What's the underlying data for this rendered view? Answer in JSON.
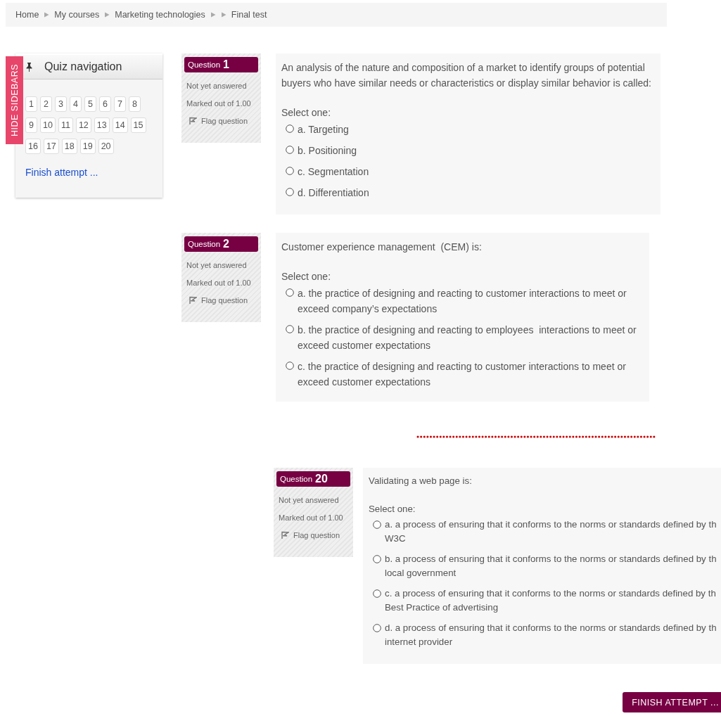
{
  "breadcrumb": [
    {
      "kind": "link",
      "label": "Home"
    },
    {
      "kind": "link",
      "label": "My courses"
    },
    {
      "kind": "link",
      "label": "Marketing technologies"
    },
    {
      "kind": "blank"
    },
    {
      "kind": "current",
      "label": "Final test"
    }
  ],
  "hide_sidebars": "HIDE SIDEBARS",
  "quiz_navigation": {
    "title": "Quiz navigation",
    "buttons": [
      "1",
      "2",
      "3",
      "4",
      "5",
      "6",
      "7",
      "8",
      "9",
      "10",
      "11",
      "12",
      "13",
      "14",
      "15",
      "16",
      "17",
      "18",
      "19",
      "20"
    ],
    "finish_link": "Finish attempt ..."
  },
  "questions": [
    {
      "label": "Question",
      "number": "1",
      "status": "Not yet answered",
      "mark": "Marked out of 1.00",
      "flag": "Flag question",
      "text": "An analysis of the nature and composition of a market to identify groups of potential buyers who have similar needs or characteristics or display similar behavior is called:",
      "prompt": "Select one:",
      "options": [
        {
          "lines": [
            "a. Targeting"
          ],
          "selected": false
        },
        {
          "lines": [
            "b. Positioning"
          ],
          "selected": false
        },
        {
          "lines": [
            "c. Segmentation"
          ],
          "selected": false
        },
        {
          "lines": [
            "d. Differentiation"
          ],
          "selected": false
        }
      ]
    },
    {
      "label": "Question",
      "number": "2",
      "status": "Not yet answered",
      "mark": "Marked out of 1.00",
      "flag": "Flag question",
      "text": "Customer experience management  (CEM) is:",
      "prompt": "Select one:",
      "options": [
        {
          "lines": [
            "a. the practice of designing and reacting to customer interactions to meet or exceed company’s expectations"
          ],
          "selected": false
        },
        {
          "lines": [
            "b. the practice of designing and reacting to employees  interactions to meet or exceed customer expectations"
          ],
          "selected": false
        },
        {
          "lines": [
            "c. the practice of designing and reacting to customer interactions to meet or exceed customer expectations"
          ],
          "selected": false
        }
      ]
    }
  ],
  "last_question": {
    "label": "Question",
    "number": "20",
    "status": "Not yet answered",
    "mark": "Marked out of 1.00",
    "flag": "Flag question",
    "text": "Validating a web page is:",
    "prompt": "Select one:",
    "options": [
      {
        "lines": [
          "a. a process of ensuring that it conforms to the norms or standards defined by th",
          "W3C"
        ],
        "selected": false
      },
      {
        "lines": [
          "b. a process of ensuring that it conforms to the norms or standards defined by th",
          "local government"
        ],
        "selected": false
      },
      {
        "lines": [
          "c. a process of ensuring that it conforms to the norms or standards defined by th",
          "Best Practice of advertising"
        ],
        "selected": false
      },
      {
        "lines": [
          "d. a process of ensuring that it conforms to the norms or standards defined by th",
          "internet provider"
        ],
        "selected": false
      }
    ]
  },
  "finish_button": "FINISH ATTEMPT ..."
}
